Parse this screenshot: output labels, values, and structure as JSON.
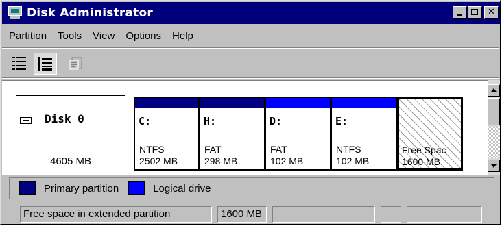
{
  "window": {
    "title": "Disk Administrator",
    "controls": {
      "minimize": "",
      "maximize": "",
      "close": "✕"
    }
  },
  "menu": [
    {
      "label": "Partition",
      "accel": "P",
      "rest": "artition"
    },
    {
      "label": "Tools",
      "accel": "T",
      "rest": "ools"
    },
    {
      "label": "View",
      "accel": "V",
      "rest": "iew"
    },
    {
      "label": "Options",
      "accel": "O",
      "rest": "ptions"
    },
    {
      "label": "Help",
      "accel": "H",
      "rest": "elp"
    }
  ],
  "toolbar": {
    "buttons": [
      {
        "icon": "volumes-view-icon",
        "state": "normal"
      },
      {
        "icon": "disk-configuration-view-icon",
        "state": "pressed"
      },
      {
        "icon": "properties-icon",
        "state": "disabled"
      }
    ]
  },
  "disk": {
    "name": "Disk 0",
    "size": "4605 MB",
    "partitions": [
      {
        "letter": "C:",
        "fs": "NTFS",
        "size": "2502 MB",
        "type": "primary"
      },
      {
        "letter": "H:",
        "fs": "FAT",
        "size": "298 MB",
        "type": "primary"
      },
      {
        "letter": "D:",
        "fs": "FAT",
        "size": "102 MB",
        "type": "logical"
      },
      {
        "letter": "E:",
        "fs": "NTFS",
        "size": "102 MB",
        "type": "logical"
      },
      {
        "letter": "",
        "fs": "Free Spac",
        "size": "1600 MB",
        "type": "free",
        "selected": true
      }
    ]
  },
  "legend": {
    "primary": {
      "label": "Primary partition",
      "color": "#000080"
    },
    "logical": {
      "label": "Logical drive",
      "color": "#0000ff"
    }
  },
  "status": {
    "description": "Free space in extended partition",
    "size": "1600 MB",
    "field3": "",
    "field4": "",
    "field5": ""
  },
  "colors": {
    "titlebar": "#00007b",
    "face": "#c0c0c0"
  }
}
